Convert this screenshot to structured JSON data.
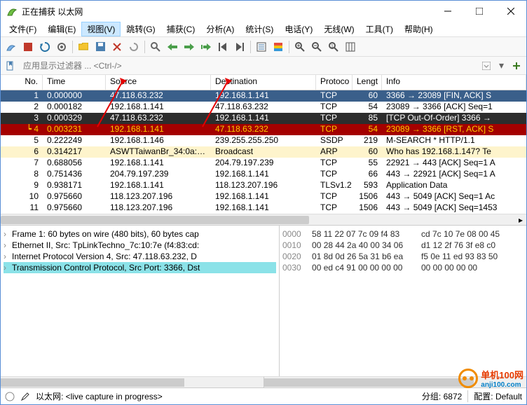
{
  "window": {
    "title": "正在捕获 以太网"
  },
  "menus": [
    {
      "label": "文件(F)"
    },
    {
      "label": "编辑(E)"
    },
    {
      "label": "视图(V)",
      "active": true
    },
    {
      "label": "跳转(G)"
    },
    {
      "label": "捕获(C)"
    },
    {
      "label": "分析(A)"
    },
    {
      "label": "统计(S)"
    },
    {
      "label": "电话(Y)"
    },
    {
      "label": "无线(W)"
    },
    {
      "label": "工具(T)"
    },
    {
      "label": "帮助(H)"
    }
  ],
  "filter": {
    "placeholder": "应用显示过滤器 ... <Ctrl-/>"
  },
  "columns": {
    "no": "No.",
    "time": "Time",
    "src": "Source",
    "dst": "Destination",
    "proto": "Protoco",
    "len": "Lengt",
    "info": "Info"
  },
  "rows": [
    {
      "no": "1",
      "time": "0.000000",
      "src": "47.118.63.232",
      "dst": "192.168.1.141",
      "proto": "TCP",
      "len": "60",
      "info": "3366 → 23089 [FIN, ACK] S",
      "style": "r-sel"
    },
    {
      "no": "2",
      "time": "0.000182",
      "src": "192.168.1.141",
      "dst": "47.118.63.232",
      "proto": "TCP",
      "len": "54",
      "info": "23089 → 3366 [ACK] Seq=1",
      "style": "r-normal"
    },
    {
      "no": "3",
      "time": "0.000329",
      "src": "47.118.63.232",
      "dst": "192.168.1.141",
      "proto": "TCP",
      "len": "85",
      "info": "[TCP Out-Of-Order] 3366 →",
      "style": "r-dark"
    },
    {
      "no": "4",
      "time": "0.003231",
      "src": "192.168.1.141",
      "dst": "47.118.63.232",
      "proto": "TCP",
      "len": "54",
      "info": "23089 → 3366 [RST, ACK] S",
      "style": "r-red"
    },
    {
      "no": "5",
      "time": "0.222249",
      "src": "192.168.1.146",
      "dst": "239.255.255.250",
      "proto": "SSDP",
      "len": "219",
      "info": "M-SEARCH * HTTP/1.1",
      "style": "r-normal"
    },
    {
      "no": "6",
      "time": "0.314217",
      "src": "ASWTTaiwanBr_34:0a:…",
      "dst": "Broadcast",
      "proto": "ARP",
      "len": "60",
      "info": "Who has 192.168.1.147? Te",
      "style": "r-highlight"
    },
    {
      "no": "7",
      "time": "0.688056",
      "src": "192.168.1.141",
      "dst": "204.79.197.239",
      "proto": "TCP",
      "len": "55",
      "info": "22921 → 443 [ACK] Seq=1 A",
      "style": "r-normal"
    },
    {
      "no": "8",
      "time": "0.751436",
      "src": "204.79.197.239",
      "dst": "192.168.1.141",
      "proto": "TCP",
      "len": "66",
      "info": "443 → 22921 [ACK] Seq=1 A",
      "style": "r-normal"
    },
    {
      "no": "9",
      "time": "0.938171",
      "src": "192.168.1.141",
      "dst": "118.123.207.196",
      "proto": "TLSv1.2",
      "len": "593",
      "info": "Application Data",
      "style": "r-normal"
    },
    {
      "no": "10",
      "time": "0.975660",
      "src": "118.123.207.196",
      "dst": "192.168.1.141",
      "proto": "TCP",
      "len": "1506",
      "info": "443 → 5049 [ACK] Seq=1 Ac",
      "style": "r-normal"
    },
    {
      "no": "11",
      "time": "0.975660",
      "src": "118.123.207.196",
      "dst": "192.168.1.141",
      "proto": "TCP",
      "len": "1506",
      "info": "443 → 5049 [ACK] Seq=1453",
      "style": "r-normal"
    }
  ],
  "tree": [
    {
      "text": "Frame 1: 60 bytes on wire (480 bits), 60 bytes cap",
      "exp": true
    },
    {
      "text": "Ethernet II, Src: TpLinkTechno_7c:10:7e (f4:83:cd:",
      "exp": true
    },
    {
      "text": "Internet Protocol Version 4, Src: 47.118.63.232, D",
      "exp": true
    },
    {
      "text": "Transmission Control Protocol, Src Port: 3366, Dst",
      "exp": true,
      "hl": true
    }
  ],
  "hex": [
    {
      "off": "0000",
      "b1": "58 11 22 07 7c 09 f4 83",
      "b2": "cd 7c 10 7e 08 00 45"
    },
    {
      "off": "0010",
      "b1": "00 28 44 2a 40 00 34 06",
      "b2": "d1 12 2f 76 3f e8 c0"
    },
    {
      "off": "0020",
      "b1": "01 8d 0d 26 5a 31 b6 ea",
      "b2": "f5 0e 11 ed 93 83 50"
    },
    {
      "off": "0030",
      "b1": "00 ed c4 91 00 00 00 00",
      "b2": "00 00 00 00 00"
    }
  ],
  "status": {
    "left": "以太网: <live capture in progress>",
    "packets": "分组: 6872",
    "profile": "配置: Default"
  },
  "watermark": {
    "name": "单机100网",
    "url": "anji100.com"
  }
}
